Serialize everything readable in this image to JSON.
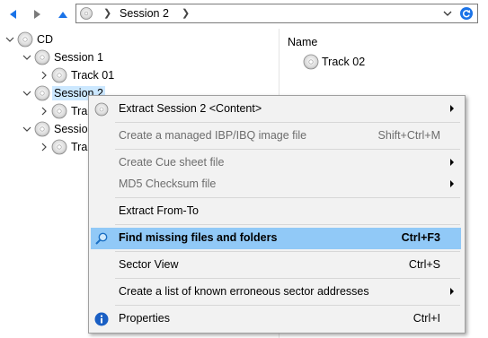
{
  "address": {
    "current": "Session 2"
  },
  "tree": [
    {
      "label": "CD"
    },
    {
      "label": "Session 1"
    },
    {
      "label": "Track 01"
    },
    {
      "label": "Session 2"
    },
    {
      "label": "Tra"
    },
    {
      "label": "Sessio"
    },
    {
      "label": "Tra"
    }
  ],
  "list": {
    "header": "Name",
    "items": [
      {
        "label": "Track 02"
      }
    ]
  },
  "menu": {
    "extract_session": {
      "label": "Extract Session 2  <Content>"
    },
    "create_ibp": {
      "label": "Create a managed IBP/IBQ image file",
      "shortcut": "Shift+Ctrl+M"
    },
    "create_cue": {
      "label": "Create Cue sheet file"
    },
    "md5": {
      "label": "MD5 Checksum file"
    },
    "extract_from_to": {
      "label": "Extract From-To"
    },
    "find_missing": {
      "label": "Find missing files and folders",
      "shortcut": "Ctrl+F3"
    },
    "sector_view": {
      "label": "Sector View",
      "shortcut": "Ctrl+S"
    },
    "known_errors": {
      "label": "Create a list of known erroneous sector addresses"
    },
    "properties": {
      "label": "Properties",
      "shortcut": "Ctrl+I"
    }
  },
  "colors": {
    "highlight": "#91c9f7",
    "selection": "#cce8ff",
    "accent": "#1a73e8"
  }
}
